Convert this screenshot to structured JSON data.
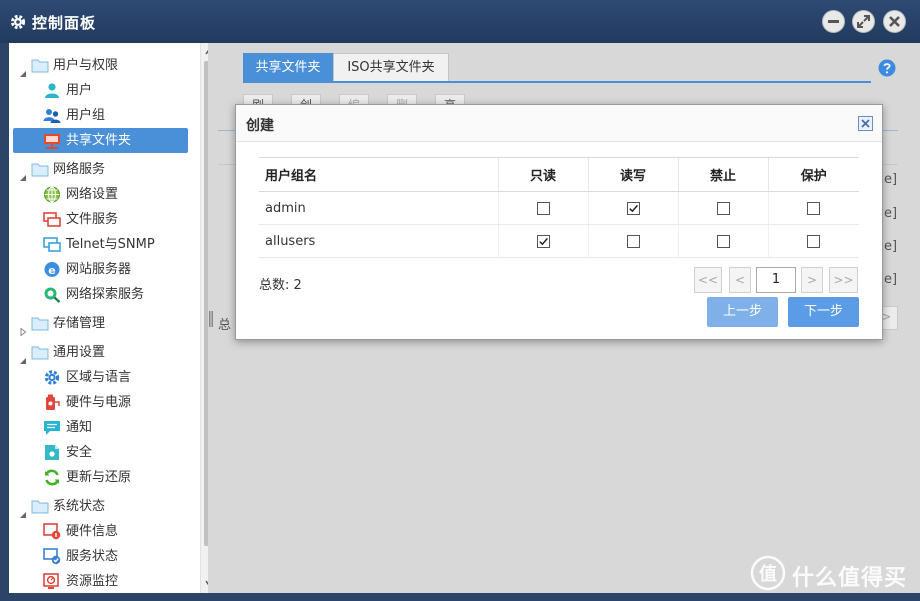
{
  "window": {
    "title": "控制面板"
  },
  "sidebar": {
    "items": [
      {
        "label": "用户与权限",
        "icon": "folder-icon",
        "kind": "group",
        "expanded": true
      },
      {
        "label": "用户",
        "icon": "user-icon",
        "kind": "child"
      },
      {
        "label": "用户组",
        "icon": "user-group-icon",
        "kind": "child"
      },
      {
        "label": "共享文件夹",
        "icon": "shared-folder-icon",
        "kind": "child",
        "selected": true
      },
      {
        "label": "网络服务",
        "icon": "folder-icon",
        "kind": "group",
        "expanded": true
      },
      {
        "label": "网络设置",
        "icon": "globe-icon",
        "kind": "child"
      },
      {
        "label": "文件服务",
        "icon": "file-service-icon",
        "kind": "child"
      },
      {
        "label": "Telnet与SNMP",
        "icon": "monitor-icon",
        "kind": "child"
      },
      {
        "label": "网站服务器",
        "icon": "web-server-icon",
        "kind": "child"
      },
      {
        "label": "网络探索服务",
        "icon": "network-discovery-icon",
        "kind": "child"
      },
      {
        "label": "存储管理",
        "icon": "folder-icon",
        "kind": "group",
        "expanded": false
      },
      {
        "label": "通用设置",
        "icon": "folder-icon",
        "kind": "group",
        "expanded": true
      },
      {
        "label": "区域与语言",
        "icon": "gear-icon",
        "kind": "child"
      },
      {
        "label": "硬件与电源",
        "icon": "power-icon",
        "kind": "child"
      },
      {
        "label": "通知",
        "icon": "chat-icon",
        "kind": "child"
      },
      {
        "label": "安全",
        "icon": "shield-icon",
        "kind": "child"
      },
      {
        "label": "更新与还原",
        "icon": "refresh-icon",
        "kind": "child"
      },
      {
        "label": "系统状态",
        "icon": "folder-icon",
        "kind": "group",
        "expanded": true
      },
      {
        "label": "硬件信息",
        "icon": "hardware-info-icon",
        "kind": "child"
      },
      {
        "label": "服务状态",
        "icon": "service-status-icon",
        "kind": "child"
      },
      {
        "label": "资源监控",
        "icon": "resource-monitor-icon",
        "kind": "child"
      }
    ]
  },
  "main": {
    "tabs": [
      {
        "label": "共享文件夹",
        "active": true
      },
      {
        "label": "ISO共享文件夹",
        "active": false
      }
    ],
    "toolbar": [
      "刷新",
      "创建",
      "编辑",
      "删除",
      "高级"
    ],
    "total_prefix": "总",
    "row_tail": "e]"
  },
  "dialog": {
    "title": "创建",
    "columns": [
      "用户组名",
      "只读",
      "读写",
      "禁止",
      "保护"
    ],
    "rows": [
      {
        "name": "admin",
        "read_only": false,
        "read_write": true,
        "deny": false,
        "protect": false
      },
      {
        "name": "allusers",
        "read_only": true,
        "read_write": false,
        "deny": false,
        "protect": false
      }
    ],
    "total_label": "总数: 2",
    "pager": {
      "first": "<<",
      "prev": "<",
      "page": "1",
      "next": ">",
      "last": ">>"
    },
    "buttons": {
      "prev": "上一步",
      "next": "下一步"
    }
  },
  "watermark": {
    "badge": "值",
    "text": "什么值得买"
  },
  "colors": {
    "accent": "#4a90d9",
    "button": "#7fb0e8",
    "titlebar": "#2e4a74"
  }
}
